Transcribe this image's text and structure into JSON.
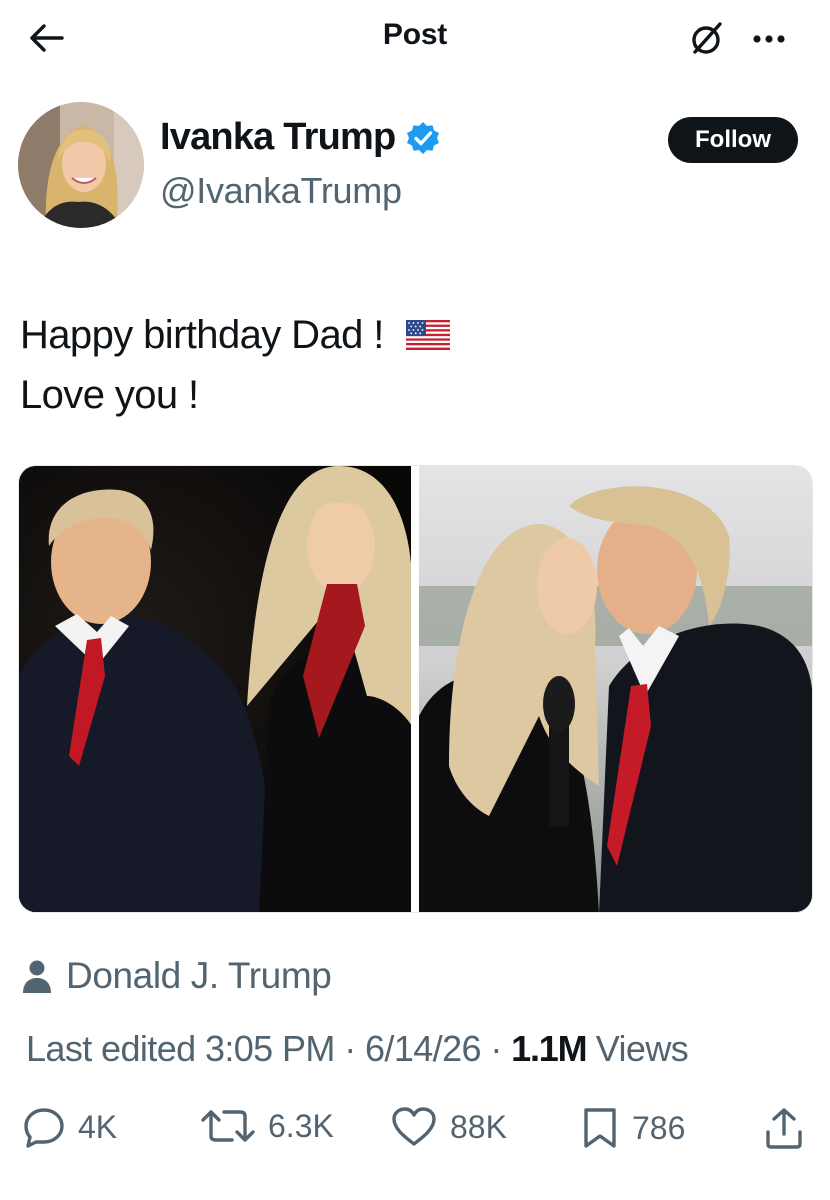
{
  "header": {
    "title": "Post",
    "back_icon": "arrow-left-icon",
    "grok_icon": "grok-icon",
    "more_icon": "more-dots-icon"
  },
  "author": {
    "display_name": "Ivanka Trump",
    "handle": "@IvankaTrump",
    "verified": true,
    "verified_color": "#1d9bf0",
    "follow_label": "Follow"
  },
  "post": {
    "text_line1": "Happy birthday Dad ! ",
    "text_line2": "Love you !",
    "emoji": "us-flag-icon",
    "media_count": 2
  },
  "tagged": {
    "name": "Donald J. Trump",
    "icon": "person-icon"
  },
  "meta": {
    "edited_prefix": "Last edited ",
    "time": "3:05 PM",
    "separator": " · ",
    "date": "6/14/26",
    "views_count": "1.1M",
    "views_label": " Views"
  },
  "actions": {
    "replies": "4K",
    "reposts": "6.3K",
    "likes": "88K",
    "bookmarks": "786"
  },
  "colors": {
    "text_primary": "#0f1419",
    "text_secondary": "#536471",
    "accent": "#1d9bf0",
    "follow_bg": "#0f1419"
  }
}
